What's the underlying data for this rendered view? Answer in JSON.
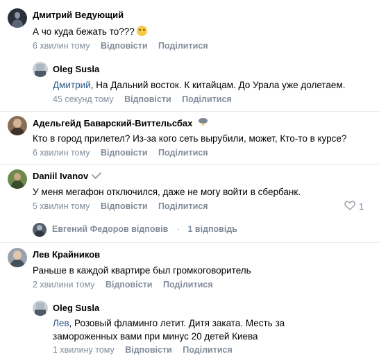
{
  "comments": [
    {
      "author": "Дмитрий Ведующий",
      "text": "А чо куда бежать то???",
      "emoji": "face-with-rolling-eyes-icon",
      "time": "6 хвилин тому",
      "reply": "Відповісти",
      "share": "Поділитися"
    },
    {
      "author": "Oleg Susla",
      "mention": "Дмитрий",
      "text": ", На Дальний восток. К китайцам. До Урала уже долетаем.",
      "time": "45 секунд тому",
      "reply": "Відповісти",
      "share": "Поділитися"
    },
    {
      "author": "Адельгейд Баварский-Виттельсбах",
      "author_badge": "cloud-lightning-emoji-icon",
      "text": "Кто в город прилетел? Из-за кого сеть вырубили, может, Кто-то в курсе?",
      "time": "6 хвилин тому",
      "reply": "Відповісти",
      "share": "Поділитися"
    },
    {
      "author": "Daniil Ivanov",
      "author_badge": "verified-check-icon",
      "text": "У меня мегафон отключился, даже не могу войти в сбербанк.",
      "time": "5 хвилин тому",
      "reply": "Відповісти",
      "share": "Поділитися",
      "likes": "1",
      "thread_author": "Евгений Федоров відповів",
      "thread_dot": "·",
      "thread_count": "1 відповідь"
    },
    {
      "author": "Лев Крайников",
      "text": "Раньше в каждой квартире был громкоговоритель",
      "time": "2 хвилини тому",
      "reply": "Відповісти",
      "share": "Поділитися"
    },
    {
      "author": "Oleg Susla",
      "mention": "Лев",
      "text": ", Розовый фламинго летит. Дитя заката. Месть за замороженных вами при минус 20 детей Киева",
      "time": "1 хвилину тому",
      "reply": "Відповісти",
      "share": "Поділитися"
    }
  ],
  "colors": {
    "meta": "#818c99",
    "mention": "#2a5885",
    "divider": "#e7e8ec"
  }
}
